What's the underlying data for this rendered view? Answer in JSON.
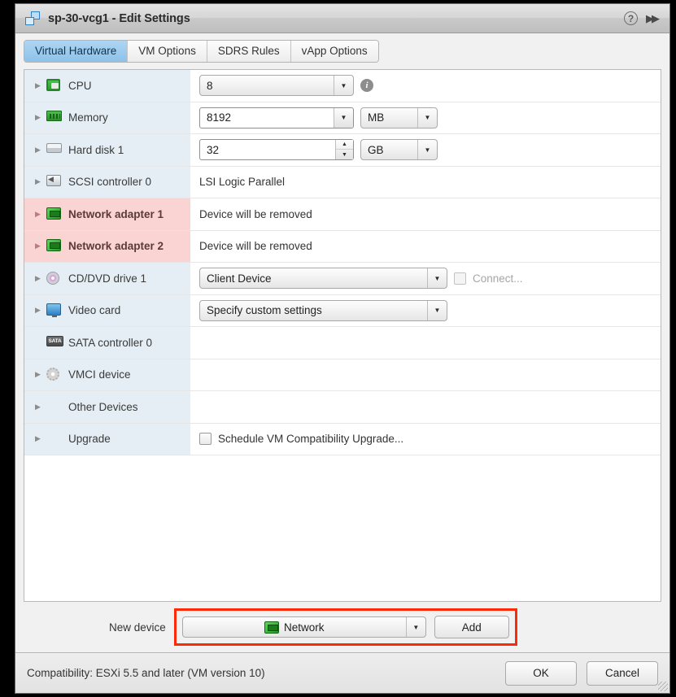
{
  "window": {
    "title": "sp-30-vcg1 - Edit Settings",
    "vm_icon": "virtual-machine-icon",
    "help_icon": "?",
    "expand_icon": "▶▶"
  },
  "tabs": [
    {
      "label": "Virtual Hardware",
      "active": true
    },
    {
      "label": "VM Options",
      "active": false
    },
    {
      "label": "SDRS Rules",
      "active": false
    },
    {
      "label": "vApp Options",
      "active": false
    }
  ],
  "devices": [
    {
      "name": "CPU",
      "icon": "cpu-icon",
      "expandable": true,
      "removed": false,
      "control": "combo",
      "value": "8",
      "info": true
    },
    {
      "name": "Memory",
      "icon": "memory-icon",
      "expandable": true,
      "removed": false,
      "control": "combo-unit",
      "value": "8192",
      "unit": "MB",
      "flat": true
    },
    {
      "name": "Hard disk 1",
      "icon": "hard-disk-icon",
      "expandable": true,
      "removed": false,
      "control": "spinner-unit",
      "value": "32",
      "unit": "GB"
    },
    {
      "name": "SCSI controller 0",
      "icon": "scsi-controller-icon",
      "expandable": true,
      "removed": false,
      "control": "text",
      "value": "LSI Logic Parallel"
    },
    {
      "name": "Network adapter 1",
      "icon": "network-adapter-icon",
      "expandable": true,
      "removed": true,
      "control": "text",
      "value": "Device will be removed"
    },
    {
      "name": "Network adapter 2",
      "icon": "network-adapter-icon",
      "expandable": true,
      "removed": true,
      "control": "text",
      "value": "Device will be removed"
    },
    {
      "name": "CD/DVD drive 1",
      "icon": "cd-dvd-icon",
      "expandable": true,
      "removed": false,
      "control": "combo-checkbox",
      "value": "Client Device",
      "checkbox_label": "Connect...",
      "checkbox_checked": false,
      "checkbox_disabled": true
    },
    {
      "name": "Video card",
      "icon": "video-card-icon",
      "expandable": true,
      "removed": false,
      "control": "combo",
      "value": "Specify custom settings"
    },
    {
      "name": "SATA controller 0",
      "icon": "sata-controller-icon",
      "expandable": false,
      "removed": false,
      "control": "none",
      "value": ""
    },
    {
      "name": "VMCI device",
      "icon": "vmci-device-icon",
      "expandable": true,
      "removed": false,
      "control": "none",
      "value": ""
    },
    {
      "name": "Other Devices",
      "icon": "none",
      "expandable": true,
      "removed": false,
      "control": "none",
      "value": ""
    },
    {
      "name": "Upgrade",
      "icon": "none",
      "expandable": true,
      "removed": false,
      "control": "checkbox",
      "checkbox_label": "Schedule VM Compatibility Upgrade...",
      "checkbox_checked": false,
      "checkbox_disabled": false
    }
  ],
  "new_device": {
    "label": "New device",
    "selected": "Network",
    "selected_icon": "network-adapter-icon",
    "add_label": "Add",
    "highlight_color": "#fb2a09"
  },
  "footer": {
    "compatibility": "Compatibility: ESXi 5.5 and later (VM version 10)",
    "ok_label": "OK",
    "cancel_label": "Cancel"
  },
  "colors": {
    "row_name_bg": "#e4eef4",
    "row_removed_bg": "#fad3d3",
    "tab_active_bg": "#8dc2ea",
    "highlight": "#fb2a09"
  }
}
